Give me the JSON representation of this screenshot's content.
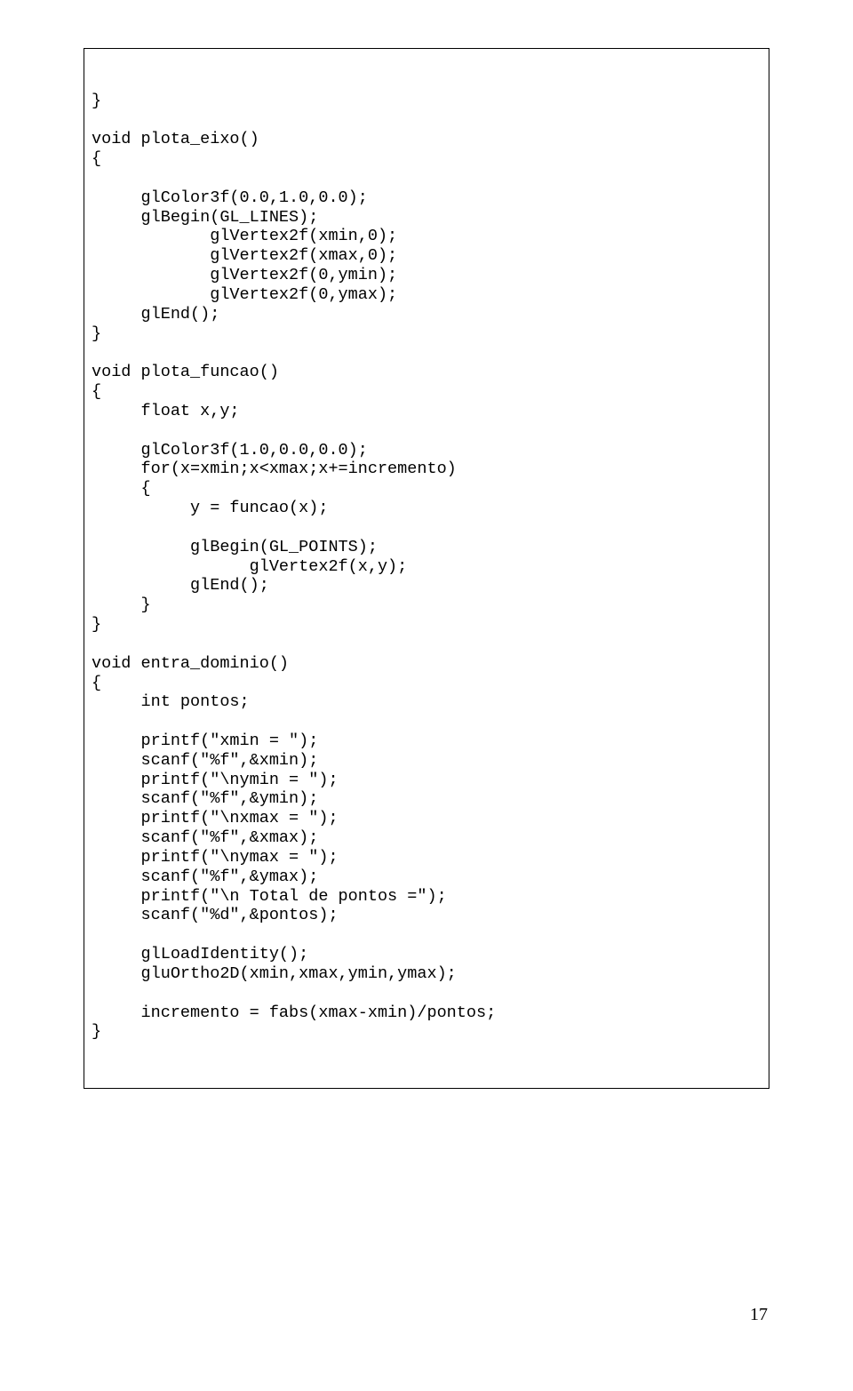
{
  "code": "}\n\nvoid plota_eixo()\n{\n\n     glColor3f(0.0,1.0,0.0);\n     glBegin(GL_LINES);\n            glVertex2f(xmin,0);\n            glVertex2f(xmax,0);\n            glVertex2f(0,ymin);\n            glVertex2f(0,ymax);\n     glEnd();\n}\n\nvoid plota_funcao()\n{\n     float x,y;\n\n     glColor3f(1.0,0.0,0.0);\n     for(x=xmin;x<xmax;x+=incremento)\n     {\n          y = funcao(x);\n\n          glBegin(GL_POINTS);\n                glVertex2f(x,y);\n          glEnd();\n     }\n}\n\nvoid entra_dominio()\n{\n     int pontos;\n\n     printf(\"xmin = \");\n     scanf(\"%f\",&xmin);\n     printf(\"\\nymin = \");\n     scanf(\"%f\",&ymin);\n     printf(\"\\nxmax = \");\n     scanf(\"%f\",&xmax);\n     printf(\"\\nymax = \");\n     scanf(\"%f\",&ymax);\n     printf(\"\\n Total de pontos =\");\n     scanf(\"%d\",&pontos);\n\n     glLoadIdentity();\n     gluOrtho2D(xmin,xmax,ymin,ymax);\n\n     incremento = fabs(xmax-xmin)/pontos;\n}",
  "page_number": "17"
}
